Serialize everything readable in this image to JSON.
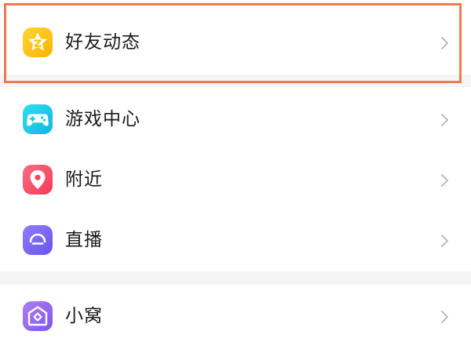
{
  "menu": {
    "items": [
      {
        "label": "好友动态",
        "icon": "friends-feed-star-icon",
        "color": "#ffc61a"
      },
      {
        "label": "游戏中心",
        "icon": "gamepad-icon",
        "color": "#22c7e8"
      },
      {
        "label": "附近",
        "icon": "location-pin-icon",
        "color": "#ff4d6a"
      },
      {
        "label": "直播",
        "icon": "live-broadcast-icon",
        "color": "#7b6cf6"
      },
      {
        "label": "小窝",
        "icon": "home-nest-icon",
        "color": "#9a6cf4"
      }
    ]
  },
  "annotation": {
    "highlight_color": "#f07a4c"
  }
}
